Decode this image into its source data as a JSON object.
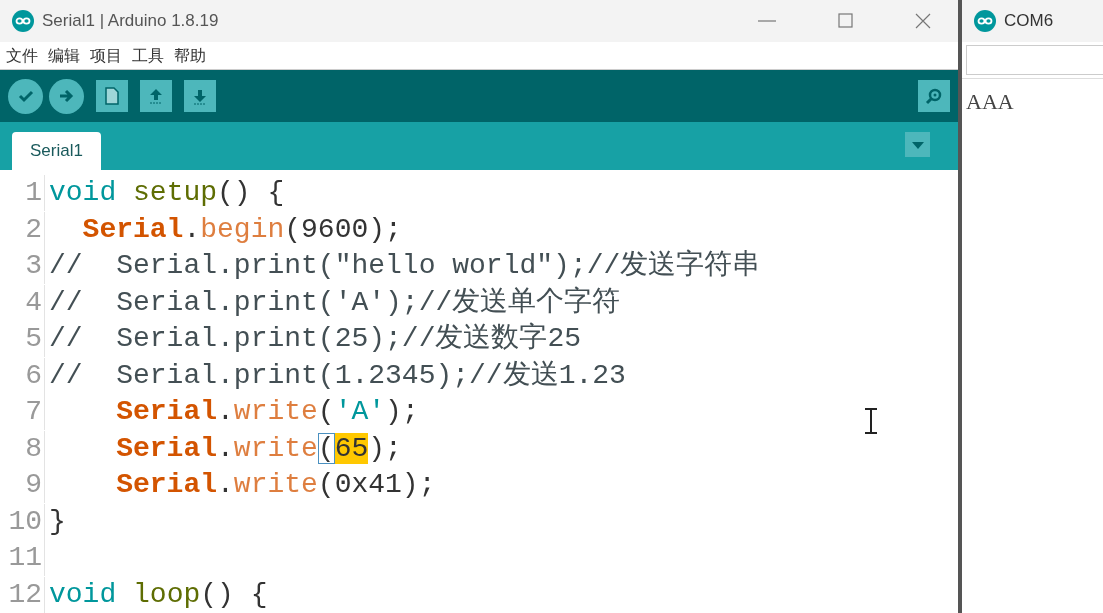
{
  "window": {
    "title": "Serial1 | Arduino 1.8.19"
  },
  "menu": [
    "文件",
    "编辑",
    "项目",
    "工具",
    "帮助"
  ],
  "tabs": [
    {
      "label": "Serial1",
      "selected": true
    }
  ],
  "code_lines": [
    {
      "number": "1",
      "segments": [
        {
          "kind": "keyword",
          "text": "void"
        },
        {
          "kind": "function",
          "text": " setup"
        },
        {
          "kind": "plain",
          "text": "() {"
        }
      ]
    },
    {
      "number": "2",
      "segments": [
        {
          "kind": "class",
          "text": "  Serial"
        },
        {
          "kind": "plain",
          "text": "."
        },
        {
          "kind": "method",
          "text": "begin"
        },
        {
          "kind": "plain",
          "text": "(9600);"
        }
      ]
    },
    {
      "number": "3",
      "segments": [
        {
          "kind": "comment",
          "text": "//  Serial.print(\"hello world\");//发送字符串"
        }
      ]
    },
    {
      "number": "4",
      "segments": [
        {
          "kind": "comment",
          "text": "//  Serial.print('A');//发送单个字符"
        }
      ]
    },
    {
      "number": "5",
      "segments": [
        {
          "kind": "comment",
          "text": "//  Serial.print(25);//发送数字25"
        }
      ]
    },
    {
      "number": "6",
      "segments": [
        {
          "kind": "comment",
          "text": "//  Serial.print(1.2345);//发送1.23"
        }
      ]
    },
    {
      "number": "7",
      "segments": [
        {
          "kind": "class",
          "text": "    Serial"
        },
        {
          "kind": "plain",
          "text": "."
        },
        {
          "kind": "method",
          "text": "write"
        },
        {
          "kind": "plain",
          "text": "("
        },
        {
          "kind": "string",
          "text": "'A'"
        },
        {
          "kind": "plain",
          "text": ");"
        }
      ]
    },
    {
      "number": "8",
      "segments": [
        {
          "kind": "class",
          "text": "    Serial"
        },
        {
          "kind": "plain",
          "text": "."
        },
        {
          "kind": "method",
          "text": "write"
        },
        {
          "kind": "bracket",
          "text": "("
        },
        {
          "kind": "highlight",
          "text": "65"
        },
        {
          "kind": "plain",
          "text": ");"
        }
      ]
    },
    {
      "number": "9",
      "segments": [
        {
          "kind": "class",
          "text": "    Serial"
        },
        {
          "kind": "plain",
          "text": "."
        },
        {
          "kind": "method",
          "text": "write"
        },
        {
          "kind": "plain",
          "text": "(0x41);"
        }
      ]
    },
    {
      "number": "10",
      "segments": [
        {
          "kind": "plain",
          "text": "}"
        }
      ]
    },
    {
      "number": "11"
    },
    {
      "number": "12",
      "segments": [
        {
          "kind": "keyword",
          "text": "void"
        },
        {
          "kind": "function",
          "text": " loop"
        },
        {
          "kind": "plain",
          "text": "() {"
        }
      ]
    }
  ],
  "serial_monitor": {
    "title": "COM6",
    "output": "AAA"
  }
}
